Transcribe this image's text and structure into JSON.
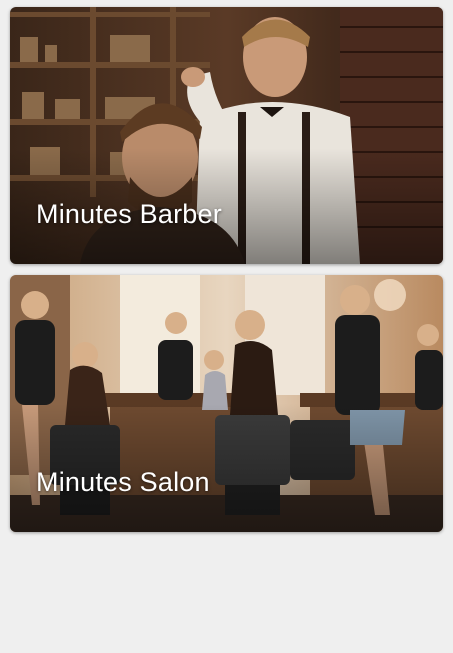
{
  "cards": [
    {
      "title": "Minutes Barber",
      "photo": "barber-haircut-photo"
    },
    {
      "title": "Minutes Salon",
      "photo": "hair-salon-interior-photo"
    }
  ],
  "colors": {
    "background": "#efefef",
    "title_text": "#ffffff"
  }
}
